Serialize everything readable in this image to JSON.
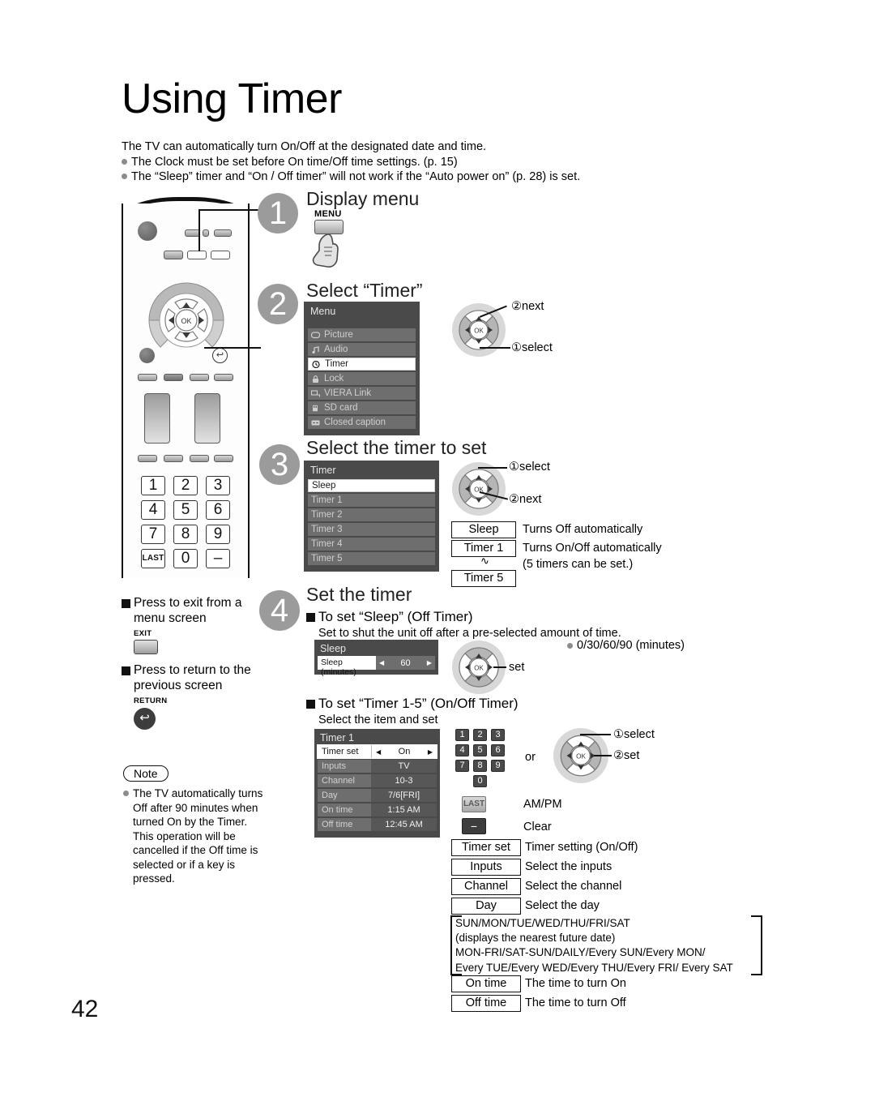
{
  "page": {
    "title": "Using Timer",
    "number": "42",
    "intro": "The TV can automatically turn On/Off at the designated date and time.",
    "intro_bullets": [
      "The Clock must be set before On time/Off time settings. (p. 15)",
      "The “Sleep” timer and “On / Off timer” will not work if the “Auto power on” (p. 28) is set."
    ]
  },
  "steps": {
    "one": {
      "num": "1",
      "heading": "Display menu",
      "button_label": "MENU"
    },
    "two": {
      "num": "2",
      "heading": "Select “Timer”",
      "menu": {
        "title": "Menu",
        "items": [
          {
            "label": "Picture",
            "icon": "picture-icon",
            "selected": false
          },
          {
            "label": "Audio",
            "icon": "audio-note-icon",
            "selected": false
          },
          {
            "label": "Timer",
            "icon": "clock-icon",
            "selected": true
          },
          {
            "label": "Lock",
            "icon": "lock-icon",
            "selected": false
          },
          {
            "label": "VIERA Link",
            "icon": "viera-link-icon",
            "selected": false
          },
          {
            "label": "SD card",
            "icon": "sd-card-icon",
            "selected": false
          },
          {
            "label": "Closed caption",
            "icon": "closed-caption-icon",
            "selected": false
          }
        ]
      },
      "dpad_top_label": "②next",
      "dpad_bottom_label": "①select"
    },
    "three": {
      "num": "3",
      "heading": "Select the timer to set",
      "timer_list": {
        "title": "Timer",
        "items": [
          {
            "label": "Sleep",
            "selected": true
          },
          {
            "label": "Timer 1",
            "selected": false
          },
          {
            "label": "Timer 2",
            "selected": false
          },
          {
            "label": "Timer 3",
            "selected": false
          },
          {
            "label": "Timer 4",
            "selected": false
          },
          {
            "label": "Timer 5",
            "selected": false
          }
        ]
      },
      "dpad_top_label": "①select",
      "dpad_bottom_label": "②next",
      "legend": [
        {
          "key": "Sleep",
          "desc": "Turns Off automatically"
        },
        {
          "key": "Timer 1",
          "desc": "Turns On/Off automatically"
        },
        {
          "key": "Timer 5",
          "desc": "(5 timers can be set.)"
        }
      ],
      "legend_tilde": "∿"
    },
    "four": {
      "num": "4",
      "heading": "Set the timer",
      "sleep_section": {
        "heading": "To set “Sleep” (Off Timer)",
        "subtext": "Set to shut the unit off after a pre-selected amount of time.",
        "panel": {
          "title": "Sleep",
          "row_label": "Sleep (minutes)",
          "row_value": "60"
        },
        "dpad_label": "set",
        "options_note": "0/30/60/90 (minutes)"
      },
      "timer_section": {
        "heading": "To set “Timer 1-5” (On/Off Timer)",
        "subtext": "Select the item and set",
        "panel": {
          "title": "Timer 1",
          "rows": [
            {
              "label": "Timer set",
              "value": "On",
              "selected": true
            },
            {
              "label": "Inputs",
              "value": "TV",
              "selected": false
            },
            {
              "label": "Channel",
              "value": "10-3",
              "selected": false
            },
            {
              "label": "Day",
              "value": "7/6[FRI]",
              "selected": false
            },
            {
              "label": "On time",
              "value": "1:15 AM",
              "selected": false
            },
            {
              "label": "Off time",
              "value": "12:45 AM",
              "selected": false
            }
          ]
        },
        "keypad": [
          "1",
          "2",
          "3",
          "4",
          "5",
          "6",
          "7",
          "8",
          "9",
          "0"
        ],
        "or_label": "or",
        "dpad_top_label": "①select",
        "dpad_bottom_label": "②set",
        "last_key": "LAST",
        "last_desc": "AM/PM",
        "minus_key": "−",
        "minus_desc": "Clear",
        "descriptions": [
          {
            "key": "Timer set",
            "desc": "Timer setting (On/Off)"
          },
          {
            "key": "Inputs",
            "desc": "Select the inputs"
          },
          {
            "key": "Channel",
            "desc": "Select the channel"
          },
          {
            "key": "Day",
            "desc": "Select the day"
          }
        ],
        "day_options": [
          "SUN/MON/TUE/WED/THU/FRI/SAT",
          "(displays the nearest future date)",
          "MON-FRI/SAT-SUN/DAILY/Every SUN/Every MON/",
          "Every TUE/Every WED/Every THU/Every FRI/ Every SAT"
        ],
        "descriptions2": [
          {
            "key": "On time",
            "desc": "The time to turn On"
          },
          {
            "key": "Off time",
            "desc": "The time to turn Off"
          }
        ]
      }
    }
  },
  "left_column": {
    "exit_block": {
      "text": "Press to exit from a menu screen",
      "key_label": "EXIT"
    },
    "return_block": {
      "text": "Press to return to the previous screen",
      "key_label": "RETURN"
    },
    "note": {
      "label": "Note",
      "body": "The TV automatically turns Off after 90 minutes when turned On by the Timer. This operation will be cancelled if the Off time is selected or if a key is pressed."
    }
  },
  "colors": {
    "osd_bg": "#4a4a4a",
    "osd_row": "#6e6e6e",
    "step_circle": "#9b9b9b",
    "bullet": "#8c8c8c"
  }
}
